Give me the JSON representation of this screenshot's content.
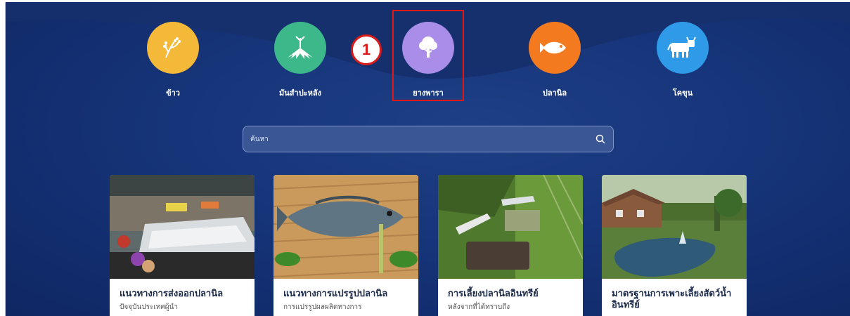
{
  "categories": [
    {
      "label": "ข้าว",
      "color": "#f5b93a",
      "icon": "rice-icon"
    },
    {
      "label": "มันสำปะหลัง",
      "color": "#3db88a",
      "icon": "cassava-icon"
    },
    {
      "label": "ยางพารา",
      "color": "#a98de8",
      "icon": "tree-icon"
    },
    {
      "label": "ปลานิล",
      "color": "#f47a1f",
      "icon": "fish-icon"
    },
    {
      "label": "โคขุน",
      "color": "#2f9be8",
      "icon": "cow-icon"
    }
  ],
  "annotation": {
    "step": "1"
  },
  "search": {
    "placeholder": "ค้นหา"
  },
  "cards": [
    {
      "title": "แนวทางการส่งออกปลานิล",
      "desc": "ปัจจุบันประเทศผู้นำ"
    },
    {
      "title": "แนวทางการแปรรูปปลานิล",
      "desc": "การแปรรูปผลผลิตทางการ"
    },
    {
      "title": "การเลี้ยงปลานิลอินทรีย์",
      "desc": "หลังจากที่ได้ทราบถึง"
    },
    {
      "title": "มาตรฐานการเพาะเลี้ยงสัตว์น้ำอินทรีย์",
      "desc": ""
    }
  ]
}
